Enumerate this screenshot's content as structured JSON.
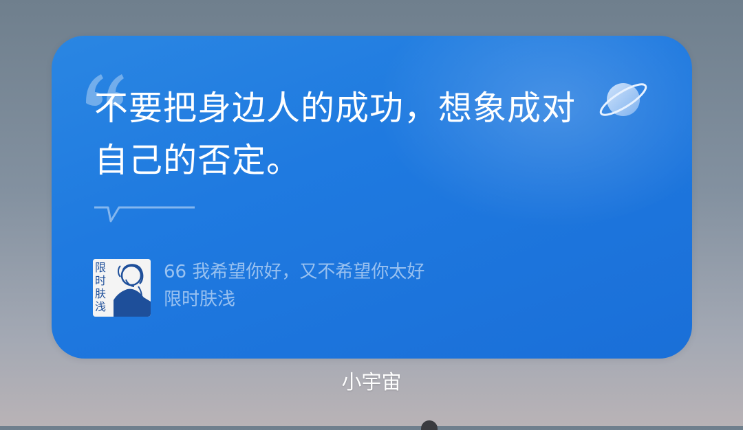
{
  "widget": {
    "quote": "不要把身边人的成功，想象成对自己的否定。",
    "source": {
      "song": "66 我希望你好，又不希望你太好",
      "artist": "限时肤浅",
      "cover_text": "限时肤浅"
    },
    "icons": {
      "quote": "open-quote-icon",
      "planet": "planet-icon",
      "speech_tail": "speech-bubble-tail-icon"
    },
    "colors": {
      "card": "#1f7ae0",
      "text": "#ffffff",
      "muted_text": "rgba(255,255,255,0.55)",
      "cover_art": "#1e4f9a"
    }
  },
  "caption": "小宇宙"
}
